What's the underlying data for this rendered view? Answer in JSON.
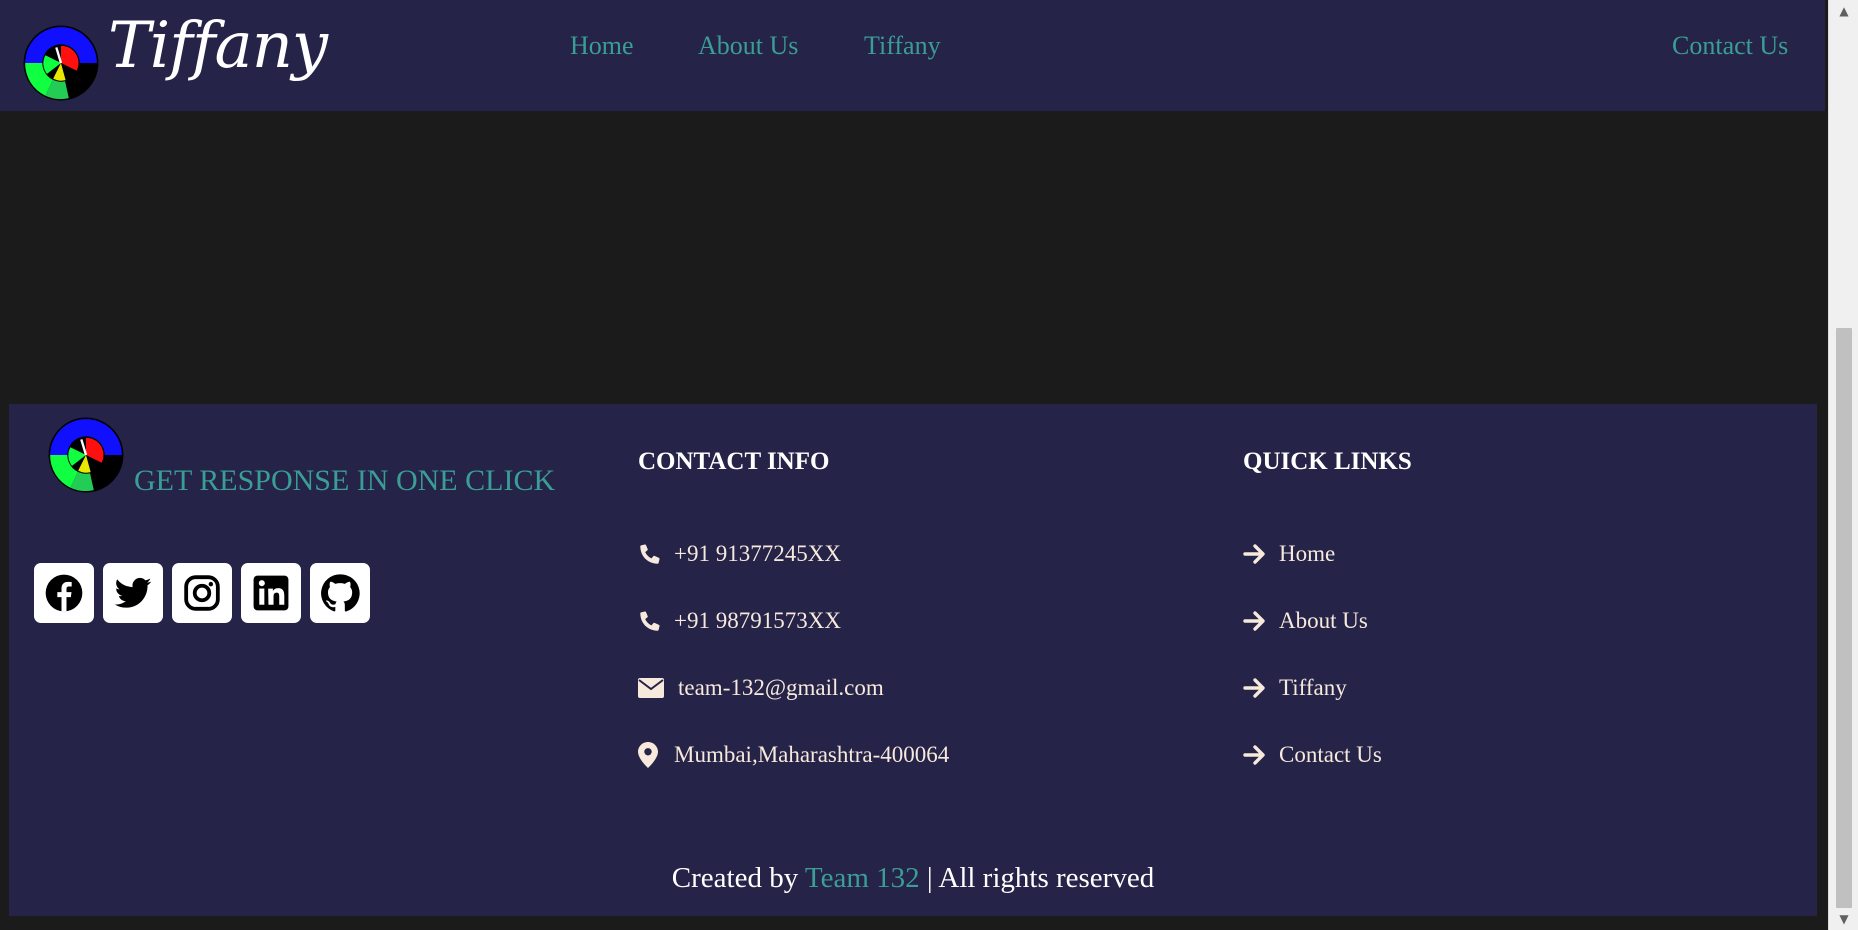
{
  "header": {
    "brand": "Tiffany",
    "nav": [
      {
        "label": "Home"
      },
      {
        "label": "About Us"
      },
      {
        "label": "Tiffany"
      },
      {
        "label": "Contact Us"
      }
    ]
  },
  "footer": {
    "tagline": "GET RESPONSE IN ONE CLICK",
    "socials": [
      {
        "icon": "facebook-icon"
      },
      {
        "icon": "twitter-icon"
      },
      {
        "icon": "instagram-icon"
      },
      {
        "icon": "linkedin-icon"
      },
      {
        "icon": "github-icon"
      }
    ],
    "contact": {
      "heading": "CONTACT INFO",
      "items": [
        {
          "icon": "phone-icon",
          "text": "+91 91377245XX"
        },
        {
          "icon": "phone-icon",
          "text": "+91 98791573XX"
        },
        {
          "icon": "envelope-icon",
          "text": "team-132@gmail.com"
        },
        {
          "icon": "map-pin-icon",
          "text": "Mumbai,Maharashtra-400064"
        }
      ]
    },
    "quick_links": {
      "heading": "QUICK LINKS",
      "items": [
        {
          "icon": "arrow-right-icon",
          "text": "Home"
        },
        {
          "icon": "arrow-right-icon",
          "text": "About Us"
        },
        {
          "icon": "arrow-right-icon",
          "text": "Tiffany"
        },
        {
          "icon": "arrow-right-icon",
          "text": "Contact Us"
        }
      ]
    },
    "credit": {
      "prefix": "Created by ",
      "team": "Team 132",
      "suffix": " | All rights reserved"
    }
  },
  "colors": {
    "header_bg": "#252347",
    "page_bg": "#1b1b1b",
    "accent_teal": "#3a9d96",
    "text_light": "#f7e9dc"
  }
}
